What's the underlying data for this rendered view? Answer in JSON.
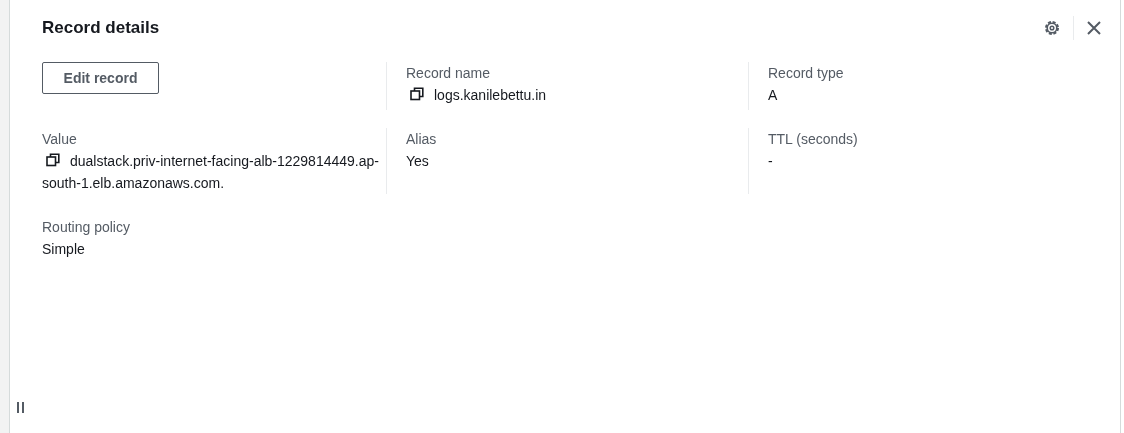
{
  "panel": {
    "title": "Record details"
  },
  "fields": [
    {
      "kind": "button",
      "label": "Edit record"
    },
    {
      "kind": "copy",
      "label": "Record name",
      "value": "logs.kanilebettu.in"
    },
    {
      "kind": "text",
      "label": "Record type",
      "value": "A"
    },
    {
      "kind": "copy",
      "label": "Value",
      "value": "dualstack.priv-internet-facing-alb-1229814449.ap-south-1.elb.amazonaws.com."
    },
    {
      "kind": "text",
      "label": "Alias",
      "value": "Yes"
    },
    {
      "kind": "text",
      "label": "TTL (seconds)",
      "value": "-"
    },
    {
      "kind": "text",
      "label": "Routing policy",
      "value": "Simple"
    }
  ]
}
